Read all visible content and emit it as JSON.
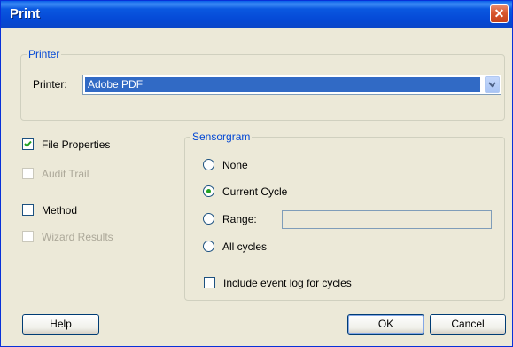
{
  "window": {
    "title": "Print",
    "close_icon": "close-icon"
  },
  "printer_group": {
    "legend": "Printer",
    "label": "Printer:",
    "selected": "Adobe PDF"
  },
  "options": [
    {
      "label": "File Properties",
      "checked": true,
      "enabled": true
    },
    {
      "label": "Audit Trail",
      "checked": false,
      "enabled": false
    },
    {
      "label": "Method",
      "checked": false,
      "enabled": true
    },
    {
      "label": "Wizard Results",
      "checked": false,
      "enabled": false
    }
  ],
  "sensorgram": {
    "legend": "Sensorgram",
    "radios": [
      {
        "label": "None",
        "selected": false
      },
      {
        "label": "Current Cycle",
        "selected": true
      },
      {
        "label": "Range:",
        "selected": false
      },
      {
        "label": "All cycles",
        "selected": false
      }
    ],
    "range_value": "",
    "event_log": {
      "label": "Include event log for cycles",
      "checked": false
    }
  },
  "buttons": {
    "help": "Help",
    "ok": "OK",
    "cancel": "Cancel"
  },
  "colors": {
    "title_bar": "#0a58e0",
    "dialog_bg": "#ece9d8",
    "group_label": "#0046d5",
    "selection": "#316ac5"
  }
}
